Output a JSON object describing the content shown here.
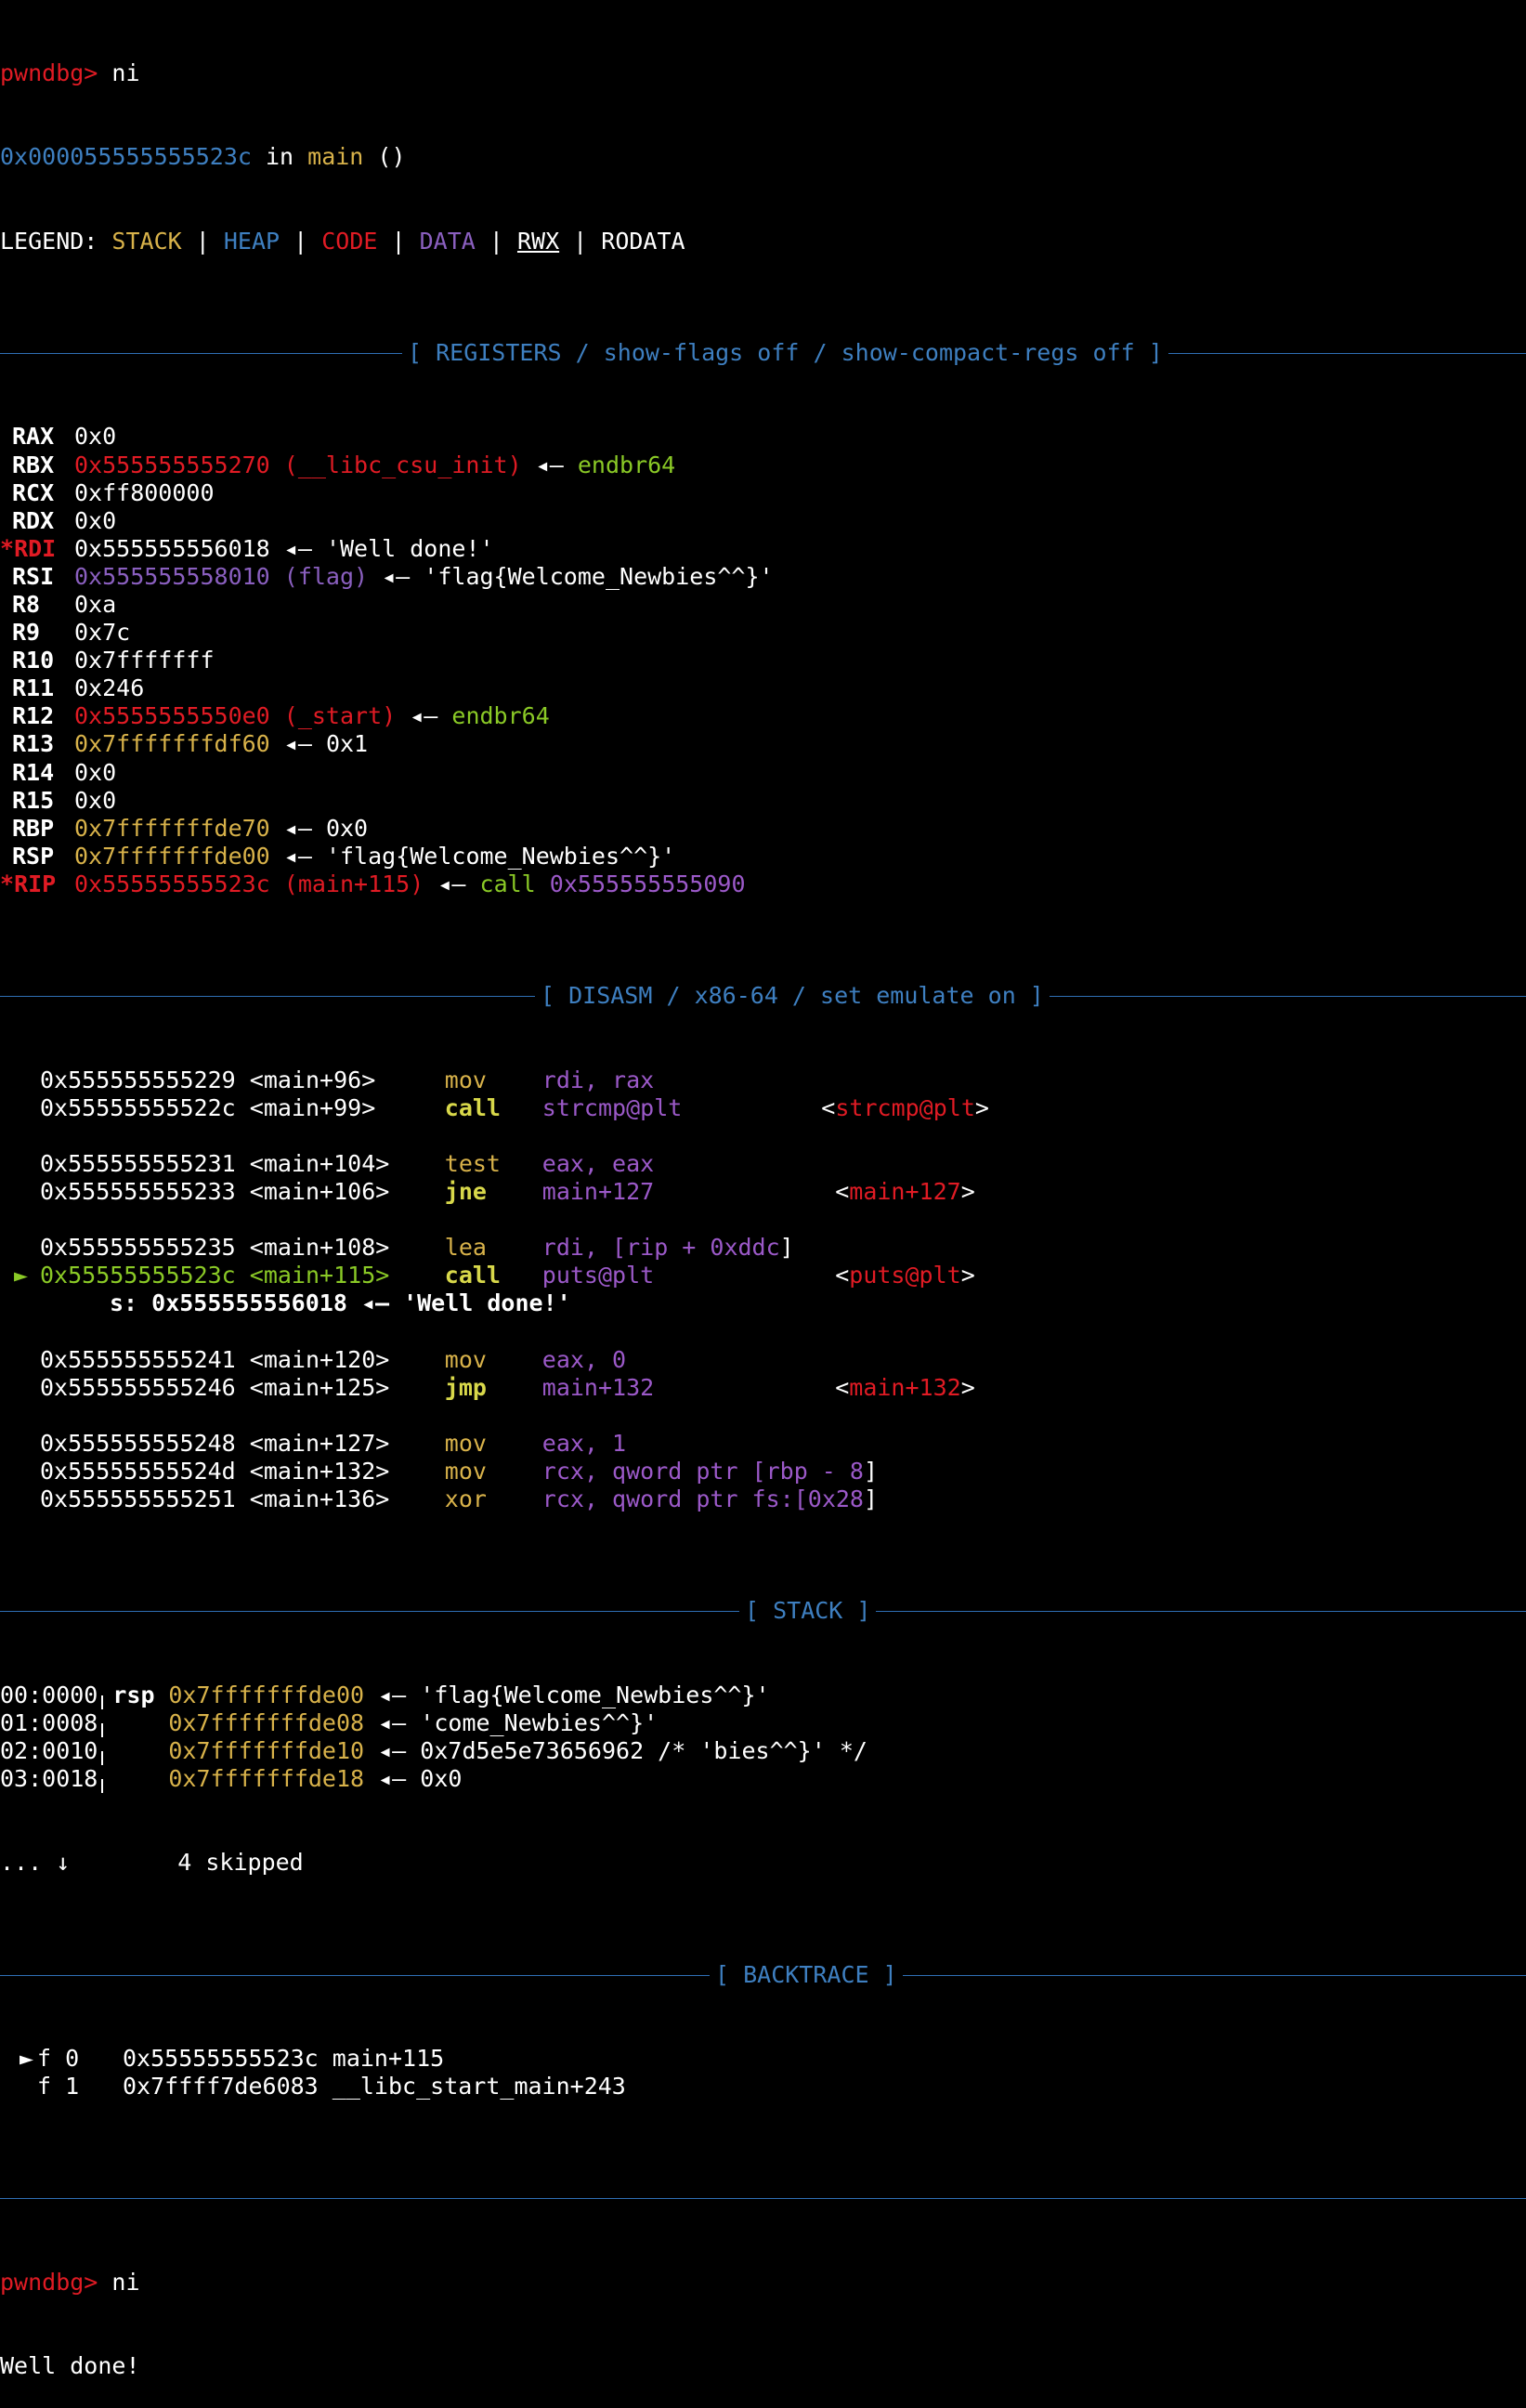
{
  "prompt": "pwndbg> ",
  "commands": [
    "ni",
    "ni"
  ],
  "location": {
    "addr": "0x000055555555523c",
    "in": " in ",
    "func": "main",
    "args": " ()"
  },
  "legend": {
    "label": "LEGEND: ",
    "stack": "STACK",
    "heap": "HEAP",
    "code": "CODE",
    "data": "DATA",
    "rwx": "RWX",
    "rodata": "RODATA",
    "sep": " | "
  },
  "sections": {
    "registers": "[ REGISTERS / show-flags off / show-compact-regs off ]",
    "disasm": "[ DISASM / x86-64 / set emulate on ]",
    "stack": "[ STACK ]",
    "backtrace": "[ BACKTRACE ]"
  },
  "registers": [
    {
      "name": "RAX",
      "value": "0x0",
      "color": "#ffffff"
    },
    {
      "name": "RBX",
      "value": "0x555555555270 (__libc_csu_init)",
      "color": "#e01b24",
      "arrow": " ◂— ",
      "target": "endbr64",
      "target_color": "#8ac926"
    },
    {
      "name": "RCX",
      "value": "0xff800000",
      "color": "#ffffff"
    },
    {
      "name": "RDX",
      "value": "0x0",
      "color": "#ffffff"
    },
    {
      "name": "RDI",
      "modified": true,
      "value": "0x555555556018",
      "color": "#ffffff",
      "arrow": " ◂— ",
      "target": "'Well done!'",
      "target_color": "#ffffff"
    },
    {
      "name": "RSI",
      "value": "0x555555558010 (flag)",
      "color": "#8a5fbf",
      "arrow": " ◂— ",
      "target": "'flag{Welcome_Newbies^^}'",
      "target_color": "#ffffff"
    },
    {
      "name": "R8",
      "value": "0xa",
      "color": "#ffffff"
    },
    {
      "name": "R9",
      "value": "0x7c",
      "color": "#ffffff"
    },
    {
      "name": "R10",
      "value": "0x7fffffff",
      "color": "#ffffff"
    },
    {
      "name": "R11",
      "value": "0x246",
      "color": "#ffffff"
    },
    {
      "name": "R12",
      "value": "0x5555555550e0 (_start)",
      "color": "#e01b24",
      "arrow": " ◂— ",
      "target": "endbr64",
      "target_color": "#8ac926"
    },
    {
      "name": "R13",
      "value": "0x7fffffffdf60",
      "color": "#d8b24a",
      "arrow": " ◂— ",
      "target": "0x1",
      "target_color": "#ffffff"
    },
    {
      "name": "R14",
      "value": "0x0",
      "color": "#ffffff"
    },
    {
      "name": "R15",
      "value": "0x0",
      "color": "#ffffff"
    },
    {
      "name": "RBP",
      "value": "0x7fffffffde70",
      "color": "#d8b24a",
      "arrow": " ◂— ",
      "target": "0x0",
      "target_color": "#ffffff"
    },
    {
      "name": "RSP",
      "value": "0x7fffffffde00",
      "color": "#d8b24a",
      "arrow": " ◂— ",
      "target": "'flag{Welcome_Newbies^^}'",
      "target_color": "#ffffff"
    },
    {
      "name": "RIP",
      "modified": true,
      "value": "0x55555555523c (main+115)",
      "color": "#e01b24",
      "arrow": " ◂— ",
      "target": "call",
      "target_color": "#8ac926",
      "target2": " 0x555555555090",
      "target2_color": "#9b59c8"
    }
  ],
  "disasm": [
    {
      "addr": "0x555555555229",
      "sym": "<main+96>",
      "op": "mov",
      "args": "rdi, rax"
    },
    {
      "addr": "0x55555555522c",
      "sym": "<main+99>",
      "op": "call",
      "args": "strcmp@plt",
      "ref": "strcmp@plt",
      "refpad": 10,
      "bold": true
    },
    {
      "blank": true
    },
    {
      "addr": "0x555555555231",
      "sym": "<main+104>",
      "op": "test",
      "args": "eax, eax"
    },
    {
      "addr": "0x555555555233",
      "sym": "<main+106>",
      "op": "jne",
      "args": "main+127",
      "ref": "main+127",
      "refpad": 13,
      "bold": true
    },
    {
      "blank": true
    },
    {
      "addr": "0x555555555235",
      "sym": "<main+108>",
      "op": "lea",
      "args": "rdi, [rip + ",
      "args_num": "0xddc",
      "args_tail": "]"
    },
    {
      "addr": "0x55555555523c",
      "sym": "<main+115>",
      "op": "call",
      "args": "puts@plt",
      "ref": "puts@plt",
      "refpad": 13,
      "current": true,
      "bold": true
    },
    {
      "note": "s: 0x555555556018 ◂— 'Well done!'"
    },
    {
      "blank": true
    },
    {
      "addr": "0x555555555241",
      "sym": "<main+120>",
      "op": "mov",
      "args": "eax, ",
      "args_num": "0"
    },
    {
      "addr": "0x555555555246",
      "sym": "<main+125>",
      "op": "jmp",
      "args": "main+132",
      "ref": "main+132",
      "refpad": 13,
      "bold": true
    },
    {
      "blank": true
    },
    {
      "addr": "0x555555555248",
      "sym": "<main+127>",
      "op": "mov",
      "args": "eax, ",
      "args_num": "1"
    },
    {
      "addr": "0x55555555524d",
      "sym": "<main+132>",
      "op": "mov",
      "args": "rcx, qword ptr [rbp - ",
      "args_num": "8",
      "args_tail": "]"
    },
    {
      "addr": "0x555555555251",
      "sym": "<main+136>",
      "op": "xor",
      "args": "rcx, qword ptr fs:[",
      "args_num": "0x28",
      "args_tail": "]"
    }
  ],
  "stack": [
    {
      "idx": "00:0000",
      "reg": "rsp",
      "addr": "0x7fffffffde00",
      "val": "'flag{Welcome_Newbies^^}'"
    },
    {
      "idx": "01:0008",
      "reg": "",
      "addr": "0x7fffffffde08",
      "val": "'come_Newbies^^}'"
    },
    {
      "idx": "02:0010",
      "reg": "",
      "addr": "0x7fffffffde10",
      "val": "0x7d5e5e73656962 /* 'bies^^}' */"
    },
    {
      "idx": "03:0018",
      "reg": "",
      "addr": "0x7fffffffde18",
      "val": "0x0"
    }
  ],
  "stack_skip": {
    "prefix": "... ↓",
    "text": "4 skipped"
  },
  "backtrace": [
    {
      "marker": "►",
      "frame": "f 0",
      "addr": "0x55555555523c",
      "sym": "main+115"
    },
    {
      "marker": " ",
      "frame": "f 1",
      "addr": "0x7ffff7de6083",
      "sym": "__libc_start_main+243"
    }
  ],
  "output": "Well done!",
  "colors": {
    "red": "#e01b24",
    "blue": "#3e7fc0",
    "yellow": "#d8b24a",
    "green": "#8ac926",
    "purple": "#8a5fbf",
    "violet": "#9b59c8"
  }
}
